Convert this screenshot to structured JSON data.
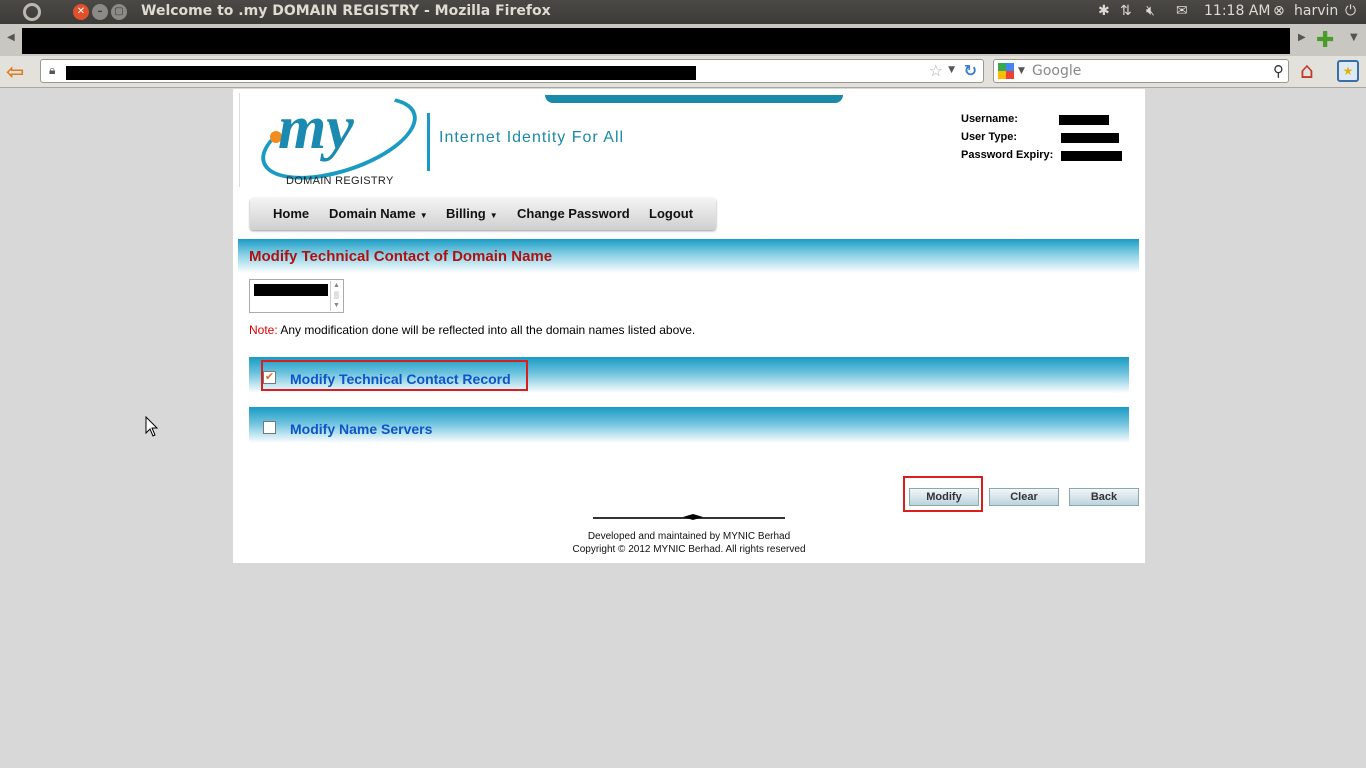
{
  "os_panel": {
    "window_title": "Welcome to .my DOMAIN REGISTRY - Mozilla Firefox",
    "time": "11:18 AM",
    "user": "harvin"
  },
  "browser": {
    "search_placeholder": "Google"
  },
  "header": {
    "logo_text": "my",
    "logo_subtitle": "DOMAIN REGISTRY",
    "tagline": "Internet Identity For All",
    "user_info": {
      "username_label": "Username:",
      "user_type_label": "User Type:",
      "password_expiry_label": "Password Expiry:"
    }
  },
  "menu": {
    "items": [
      {
        "label": "Home"
      },
      {
        "label": "Domain Name"
      },
      {
        "label": "Billing"
      },
      {
        "label": "Change Password"
      },
      {
        "label": "Logout"
      }
    ]
  },
  "main": {
    "title": "Modify Technical Contact of Domain Name",
    "note_label": "Note:",
    "note_text": " Any modification done will be reflected into all the domain names listed above.",
    "sections": [
      {
        "label": "Modify Technical Contact Record",
        "checked": true
      },
      {
        "label": "Modify Name Servers",
        "checked": false
      }
    ],
    "buttons": {
      "modify": "Modify",
      "clear": "Clear",
      "back": "Back"
    }
  },
  "footer": {
    "line1": "Developed and maintained by MYNIC Berhad",
    "line2": "Copyright © 2012 MYNIC Berhad. All rights reserved"
  },
  "colors": {
    "accent": "#1a9bc4",
    "title_red": "#b01010",
    "link_blue": "#0b55c8",
    "highlight_red": "#d81e1e"
  }
}
